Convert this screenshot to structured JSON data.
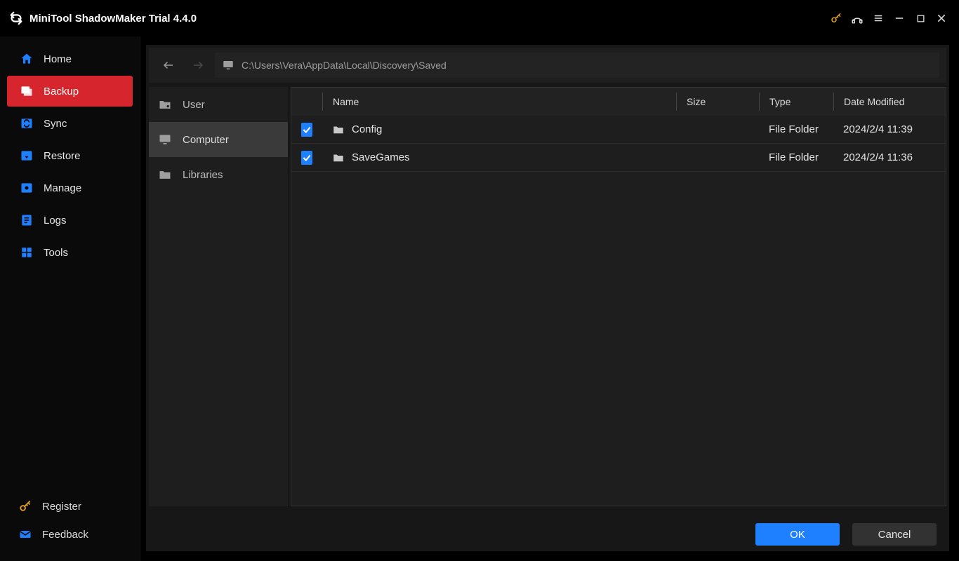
{
  "app": {
    "title": "MiniTool ShadowMaker Trial 4.4.0"
  },
  "sidebar": {
    "items": [
      {
        "label": "Home"
      },
      {
        "label": "Backup"
      },
      {
        "label": "Sync"
      },
      {
        "label": "Restore"
      },
      {
        "label": "Manage"
      },
      {
        "label": "Logs"
      },
      {
        "label": "Tools"
      }
    ],
    "register": "Register",
    "feedback": "Feedback"
  },
  "path": "C:\\Users\\Vera\\AppData\\Local\\Discovery\\Saved",
  "tree": {
    "user": "User",
    "computer": "Computer",
    "libraries": "Libraries"
  },
  "columns": {
    "name": "Name",
    "size": "Size",
    "type": "Type",
    "modified": "Date Modified"
  },
  "rows": [
    {
      "name": "Config",
      "size": "",
      "type": "File Folder",
      "modified": "2024/2/4 11:39",
      "checked": true
    },
    {
      "name": "SaveGames",
      "size": "",
      "type": "File Folder",
      "modified": "2024/2/4 11:36",
      "checked": true
    }
  ],
  "buttons": {
    "ok": "OK",
    "cancel": "Cancel"
  }
}
